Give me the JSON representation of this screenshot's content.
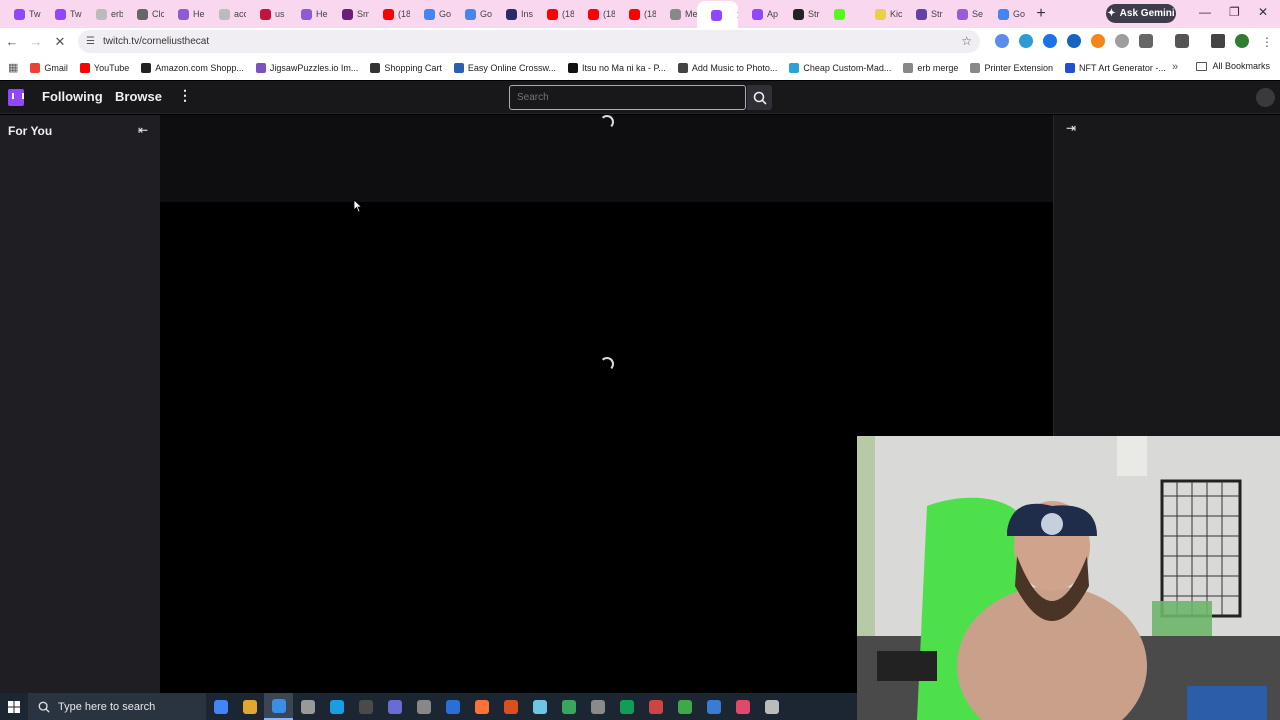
{
  "browser": {
    "tabs": [
      {
        "label": "Tw",
        "color": "#9147ff"
      },
      {
        "label": "Tw",
        "color": "#9147ff"
      },
      {
        "label": "erb",
        "color": "#bbbbbb"
      },
      {
        "label": "Clc",
        "color": "#666666"
      },
      {
        "label": "He",
        "color": "#8e5bd4"
      },
      {
        "label": "acc",
        "color": "#bbbbbb"
      },
      {
        "label": "us",
        "color": "#c4123a"
      },
      {
        "label": "He",
        "color": "#8e5bd4"
      },
      {
        "label": "Sm",
        "color": "#6b1f7a"
      },
      {
        "label": "(18",
        "color": "#ff0000"
      },
      {
        "label": "Go",
        "color": "#4285f4"
      },
      {
        "label": "Go",
        "color": "#4285f4"
      },
      {
        "label": "Ins",
        "color": "#2b2b6a"
      },
      {
        "label": "(18",
        "color": "#ff0000"
      },
      {
        "label": "(18",
        "color": "#ff0000"
      },
      {
        "label": "(18",
        "color": "#ff0000"
      },
      {
        "label": "Me",
        "color": "#888888"
      },
      {
        "label": "",
        "color": "#9147ff",
        "active": true
      },
      {
        "label": "Ap",
        "color": "#9147ff"
      },
      {
        "label": "Str",
        "color": "#222222"
      },
      {
        "label": "",
        "color": "#53fc18"
      },
      {
        "label": "Kic",
        "color": "#e8d04a"
      },
      {
        "label": "Str",
        "color": "#6441a5"
      },
      {
        "label": "Se",
        "color": "#9a5cd6"
      },
      {
        "label": "Go",
        "color": "#4285f4"
      }
    ],
    "gemini_label": "Ask Gemini",
    "url": "twitch.tv/corneliusthecat",
    "bookmarks": [
      {
        "label": "Gmail",
        "color": "#ea4335"
      },
      {
        "label": "YouTube",
        "color": "#ff0000"
      },
      {
        "label": "Amazon.com Shopp...",
        "color": "#222222"
      },
      {
        "label": "JigsawPuzzles.io Im...",
        "color": "#7b53c1"
      },
      {
        "label": "Shopping Cart",
        "color": "#333333"
      },
      {
        "label": "Easy Online Crossw...",
        "color": "#2b5fb3"
      },
      {
        "label": "Itsu no Ma ni ka - P...",
        "color": "#111111"
      },
      {
        "label": "Add Music to Photo...",
        "color": "#444444"
      },
      {
        "label": "Cheap Custom-Mad...",
        "color": "#2aa3d6"
      },
      {
        "label": "erb merge",
        "color": "#888888"
      },
      {
        "label": "Printer Extension",
        "color": "#888888"
      },
      {
        "label": "NFT Art Generator -...",
        "color": "#1f4fd6"
      }
    ],
    "all_bookmarks": "All Bookmarks"
  },
  "twitch": {
    "nav_following": "Following",
    "nav_browse": "Browse",
    "search_placeholder": "Search",
    "sidebar_title": "For You"
  },
  "taskbar": {
    "search_placeholder": "Type here to search",
    "icon_colors": [
      "#4285f4",
      "#e0a82e",
      "#3a8ee6",
      "#999999",
      "#1b9de2",
      "#4a4a4a",
      "#6b6bd6",
      "#888888",
      "#2a6fd6",
      "#ff7139",
      "#d94f1e",
      "#6ec6e6",
      "#3aa55d",
      "#8a8a8a",
      "#0f9d58",
      "#c44",
      "#3ea84b",
      "#3a7bd5",
      "#e04a6a",
      "#bbbbbb"
    ]
  }
}
